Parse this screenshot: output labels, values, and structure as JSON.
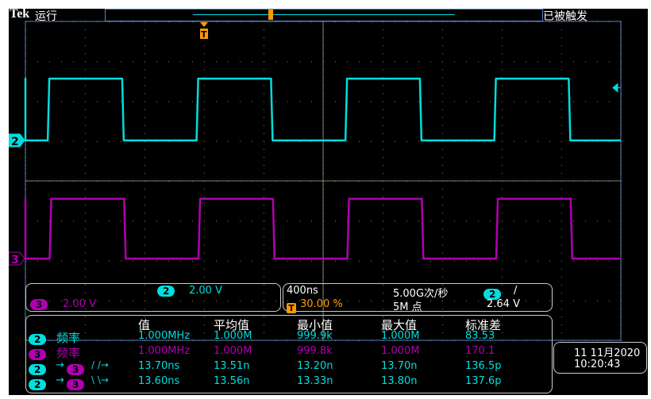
{
  "header": {
    "brand": "Tek",
    "run_state": "运行",
    "trigger_state": "已被触发"
  },
  "channels": {
    "ch2": {
      "label": "2",
      "scale": "2.00 V",
      "color": "#00dede"
    },
    "ch3": {
      "label": "3",
      "scale": "2.00 V",
      "color": "#b000b0"
    }
  },
  "timebase": {
    "scale": "400ns",
    "trigger_position": "30.00 %",
    "sample_rate": "5.00G次/秒",
    "record_length": "5M 点",
    "trigger_marker": "T"
  },
  "trigger": {
    "source": "2",
    "slope": "/",
    "level": "2.64 V"
  },
  "measurements": {
    "headers": [
      "值",
      "平均值",
      "最小值",
      "最大值",
      "标准差"
    ],
    "rows": [
      {
        "src": "2",
        "dst": "",
        "name": "频率",
        "color": "cy",
        "values": [
          "1.000MHz",
          "1.000M",
          "999.9k",
          "1.000M",
          "83.53"
        ]
      },
      {
        "src": "3",
        "dst": "",
        "name": "频率",
        "color": "mg",
        "values": [
          "1.000MHz",
          "1.000M",
          "999.8k",
          "1.000M",
          "170.1"
        ]
      },
      {
        "src": "2",
        "dst": "3",
        "name": "/ /→",
        "color": "cy",
        "values": [
          "13.70ns",
          "13.51n",
          "13.20n",
          "13.70n",
          "136.5p"
        ]
      },
      {
        "src": "2",
        "dst": "3",
        "name": "\\ \\→",
        "color": "cy",
        "values": [
          "13.60ns",
          "13.56n",
          "13.33n",
          "13.80n",
          "137.6p"
        ]
      }
    ]
  },
  "datetime": {
    "date": "11 11月2020",
    "time": "10:20:43"
  },
  "waveforms": {
    "period_ns": 1000,
    "duty": 0.5,
    "time_per_div_ns": 400,
    "volts_per_div": 2.0,
    "ch2": {
      "low_v": 0,
      "high_v": 3.1,
      "first_rise_ns": 150
    },
    "ch3": {
      "low_v": 0,
      "high_v": 3.0,
      "first_rise_ns": 163
    }
  }
}
